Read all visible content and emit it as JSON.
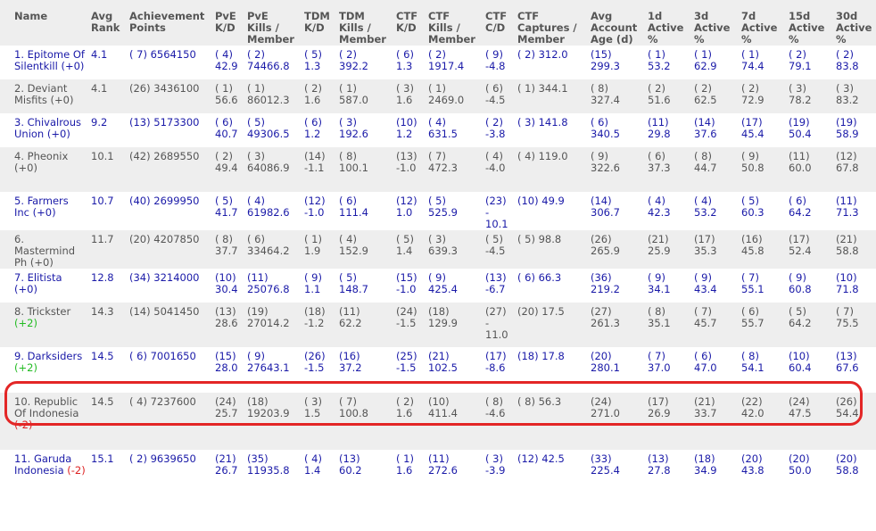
{
  "headers": [
    [
      "Name"
    ],
    [
      "Avg",
      "Rank"
    ],
    [
      "Achievement",
      "Points"
    ],
    [
      "PvE",
      "K/D"
    ],
    [
      "PvE",
      "Kills /",
      "Member"
    ],
    [
      "TDM",
      "K/D"
    ],
    [
      "TDM",
      "Kills /",
      "Member"
    ],
    [
      "CTF",
      "K/D"
    ],
    [
      "CTF",
      "Kills /",
      "Member"
    ],
    [
      "CTF",
      "C/D"
    ],
    [
      "CTF",
      "Captures /",
      "Member"
    ],
    [
      "Avg",
      "Account",
      "Age (d)"
    ],
    [
      "1d",
      "Active",
      "%"
    ],
    [
      "3d",
      "Active",
      "%"
    ],
    [
      "7d",
      "Active",
      "%"
    ],
    [
      "15d",
      "Active",
      "%"
    ],
    [
      "30d",
      "Active",
      "%"
    ]
  ],
  "rows": [
    {
      "name": "1. Epitome Of Silentkill",
      "change": "(+0)",
      "change_type": "neu",
      "color": "blue",
      "avg_rank": "4.1",
      "ach": "( 7) 6564150",
      "cells": [
        [
          "( 4)",
          "42.9"
        ],
        [
          "( 2)",
          "74466.8"
        ],
        [
          "( 5)",
          "1.3"
        ],
        [
          "( 2)",
          "392.2"
        ],
        [
          "( 6)",
          "1.3"
        ],
        [
          "( 2)",
          "1917.4"
        ],
        [
          "( 9)",
          "-4.8"
        ],
        [
          "( 2) 312.0"
        ],
        [
          "(15)",
          "299.3"
        ],
        [
          "( 1)",
          "53.2"
        ],
        [
          "( 1)",
          "62.9"
        ],
        [
          "( 1)",
          "74.4"
        ],
        [
          "( 2)",
          "79.1"
        ],
        [
          "( 2)",
          "83.8"
        ]
      ]
    },
    {
      "name": "2. Deviant Misfits",
      "change": "(+0)",
      "change_type": "neu",
      "color": "gray",
      "avg_rank": "4.1",
      "ach": "(26) 3436100",
      "cells": [
        [
          "( 1)",
          "56.6"
        ],
        [
          "( 1)",
          "86012.3"
        ],
        [
          "( 2)",
          "1.6"
        ],
        [
          "( 1)",
          "587.0"
        ],
        [
          "( 3)",
          "1.6"
        ],
        [
          "( 1)",
          "2469.0"
        ],
        [
          "( 6)",
          "-4.5"
        ],
        [
          "( 1) 344.1"
        ],
        [
          "( 8)",
          "327.4"
        ],
        [
          "( 2)",
          "51.6"
        ],
        [
          "( 2)",
          "62.5"
        ],
        [
          "( 2)",
          "72.9"
        ],
        [
          "( 3)",
          "78.2"
        ],
        [
          "( 3)",
          "83.2"
        ]
      ]
    },
    {
      "name": "3. Chivalrous Union",
      "change": "(+0)",
      "change_type": "neu",
      "color": "blue",
      "avg_rank": "9.2",
      "ach": "(13) 5173300",
      "cells": [
        [
          "( 6)",
          "40.7"
        ],
        [
          "( 5)",
          "49306.5"
        ],
        [
          "( 6)",
          "1.2"
        ],
        [
          "( 3)",
          "192.6"
        ],
        [
          "(10)",
          "1.2"
        ],
        [
          "( 4)",
          "631.5"
        ],
        [
          "( 2)",
          "-3.8"
        ],
        [
          "( 3) 141.8"
        ],
        [
          "( 6)",
          "340.5"
        ],
        [
          "(11)",
          "29.8"
        ],
        [
          "(14)",
          "37.6"
        ],
        [
          "(17)",
          "45.4"
        ],
        [
          "(19)",
          "50.4"
        ],
        [
          "(19)",
          "58.9"
        ]
      ]
    },
    {
      "name": "4. Pheonix",
      "change": "(+0)",
      "change_type": "neu",
      "color": "gray",
      "avg_rank": "10.1",
      "ach": "(42) 2689550",
      "cells": [
        [
          "( 2)",
          "49.4"
        ],
        [
          "( 3)",
          "64086.9"
        ],
        [
          "(14)",
          "-1.1"
        ],
        [
          "( 8)",
          "100.1"
        ],
        [
          "(13)",
          "-1.0"
        ],
        [
          "( 7)",
          "472.3"
        ],
        [
          "( 4)",
          "-4.0"
        ],
        [
          "( 4) 119.0"
        ],
        [
          "( 9)",
          "322.6"
        ],
        [
          "( 6)",
          "37.3"
        ],
        [
          "( 8)",
          "44.7"
        ],
        [
          "( 9)",
          "50.8"
        ],
        [
          "(11)",
          "60.0"
        ],
        [
          "(12)",
          "67.8"
        ]
      ]
    },
    {
      "name": "5. Farmers Inc",
      "change": "(+0)",
      "change_type": "neu",
      "color": "blue",
      "avg_rank": "10.7",
      "ach": "(40) 2699950",
      "cells": [
        [
          "( 5)",
          "41.7"
        ],
        [
          "( 4)",
          "61982.6"
        ],
        [
          "(12)",
          "-1.0"
        ],
        [
          "( 6)",
          "111.4"
        ],
        [
          "(12)",
          "1.0"
        ],
        [
          "( 5)",
          "525.9"
        ],
        [
          "(23)",
          "-",
          "10.1"
        ],
        [
          "(10) 49.9"
        ],
        [
          "(14)",
          "306.7"
        ],
        [
          "( 4)",
          "42.3"
        ],
        [
          "( 4)",
          "53.2"
        ],
        [
          "( 5)",
          "60.3"
        ],
        [
          "( 6)",
          "64.2"
        ],
        [
          "(11)",
          "71.3"
        ]
      ]
    },
    {
      "name": "6. Mastermind Ph",
      "change": "(+0)",
      "change_type": "neu",
      "color": "gray",
      "avg_rank": "11.7",
      "ach": "(20) 4207850",
      "cells": [
        [
          "( 8)",
          "37.7"
        ],
        [
          "( 6)",
          "33464.2"
        ],
        [
          "( 1)",
          "1.9"
        ],
        [
          "( 4)",
          "152.9"
        ],
        [
          "( 5)",
          "1.4"
        ],
        [
          "( 3)",
          "639.3"
        ],
        [
          "( 5)",
          "-4.5"
        ],
        [
          "( 5) 98.8"
        ],
        [
          "(26)",
          "265.9"
        ],
        [
          "(21)",
          "25.9"
        ],
        [
          "(17)",
          "35.3"
        ],
        [
          "(16)",
          "45.8"
        ],
        [
          "(17)",
          "52.4"
        ],
        [
          "(21)",
          "58.8"
        ]
      ]
    },
    {
      "name": "7. Elitista",
      "change": "(+0)",
      "change_type": "neu",
      "color": "blue",
      "avg_rank": "12.8",
      "ach": "(34) 3214000",
      "cells": [
        [
          "(10)",
          "30.4"
        ],
        [
          "(11)",
          "25076.8"
        ],
        [
          "( 9)",
          "1.1"
        ],
        [
          "( 5)",
          "148.7"
        ],
        [
          "(15)",
          "-1.0"
        ],
        [
          "( 9)",
          "425.4"
        ],
        [
          "(13)",
          "-6.7"
        ],
        [
          "( 6) 66.3"
        ],
        [
          "(36)",
          "219.2"
        ],
        [
          "( 9)",
          "34.1"
        ],
        [
          "( 9)",
          "43.4"
        ],
        [
          "( 7)",
          "55.1"
        ],
        [
          "( 9)",
          "60.8"
        ],
        [
          "(10)",
          "71.8"
        ]
      ]
    },
    {
      "name": "8. Trickster",
      "change": "(+2)",
      "change_type": "pos",
      "color": "gray",
      "avg_rank": "14.3",
      "ach": "(14) 5041450",
      "cells": [
        [
          "(13)",
          "28.6"
        ],
        [
          "(19)",
          "27014.2"
        ],
        [
          "(18)",
          "-1.2"
        ],
        [
          "(11)",
          "62.2"
        ],
        [
          "(24)",
          "-1.5"
        ],
        [
          "(18)",
          "129.9"
        ],
        [
          "(27)",
          "-",
          "11.0"
        ],
        [
          "(20) 17.5"
        ],
        [
          "(27)",
          "261.3"
        ],
        [
          "( 8)",
          "35.1"
        ],
        [
          "( 7)",
          "45.7"
        ],
        [
          "( 6)",
          "55.7"
        ],
        [
          "( 5)",
          "64.2"
        ],
        [
          "( 7)",
          "75.5"
        ]
      ]
    },
    {
      "name": "9. Darksiders",
      "change": "(+2)",
      "change_type": "pos",
      "color": "blue",
      "avg_rank": "14.5",
      "ach": "( 6) 7001650",
      "cells": [
        [
          "(15)",
          "28.0"
        ],
        [
          "( 9)",
          "27643.1"
        ],
        [
          "(26)",
          "-1.5"
        ],
        [
          "(16)",
          "37.2"
        ],
        [
          "(25)",
          "-1.5"
        ],
        [
          "(21)",
          "102.5"
        ],
        [
          "(17)",
          "-8.6"
        ],
        [
          "(18) 17.8"
        ],
        [
          "(20)",
          "280.1"
        ],
        [
          "( 7)",
          "37.0"
        ],
        [
          "( 6)",
          "47.0"
        ],
        [
          "( 8)",
          "54.1"
        ],
        [
          "(10)",
          "60.4"
        ],
        [
          "(13)",
          "67.6"
        ]
      ]
    },
    {
      "name": "10. Republic Of Indonesia",
      "change": "(-2)",
      "change_type": "neg",
      "color": "gray",
      "avg_rank": "14.5",
      "ach": "( 4) 7237600",
      "cells": [
        [
          "(24)",
          "25.7"
        ],
        [
          "(18)",
          "19203.9"
        ],
        [
          "( 3)",
          "1.5"
        ],
        [
          "( 7)",
          "100.8"
        ],
        [
          "( 2)",
          "1.6"
        ],
        [
          "(10)",
          "411.4"
        ],
        [
          "( 8)",
          "-4.6"
        ],
        [
          "( 8) 56.3"
        ],
        [
          "(24)",
          "271.0"
        ],
        [
          "(17)",
          "26.9"
        ],
        [
          "(21)",
          "33.7"
        ],
        [
          "(22)",
          "42.0"
        ],
        [
          "(24)",
          "47.5"
        ],
        [
          "(26)",
          "54.4"
        ]
      ]
    },
    {
      "name": "11. Garuda Indonesia",
      "change": "(-2)",
      "change_type": "neg",
      "color": "blue",
      "avg_rank": "15.1",
      "ach": "( 2) 9639650",
      "cells": [
        [
          "(21)",
          "26.7"
        ],
        [
          "(35)",
          "11935.8"
        ],
        [
          "( 4)",
          "1.4"
        ],
        [
          "(13)",
          "60.2"
        ],
        [
          "( 1)",
          "1.6"
        ],
        [
          "(11)",
          "272.6"
        ],
        [
          "( 3)",
          "-3.9"
        ],
        [
          "(12) 42.5"
        ],
        [
          "(33)",
          "225.4"
        ],
        [
          "(13)",
          "27.8"
        ],
        [
          "(18)",
          "34.9"
        ],
        [
          "(20)",
          "43.8"
        ],
        [
          "(20)",
          "50.0"
        ],
        [
          "(20)",
          "58.8"
        ]
      ]
    }
  ],
  "row_heights": [
    51,
    38,
    38,
    38,
    50,
    38,
    38,
    38,
    50,
    51,
    64,
    50
  ],
  "highlight_row": 9
}
